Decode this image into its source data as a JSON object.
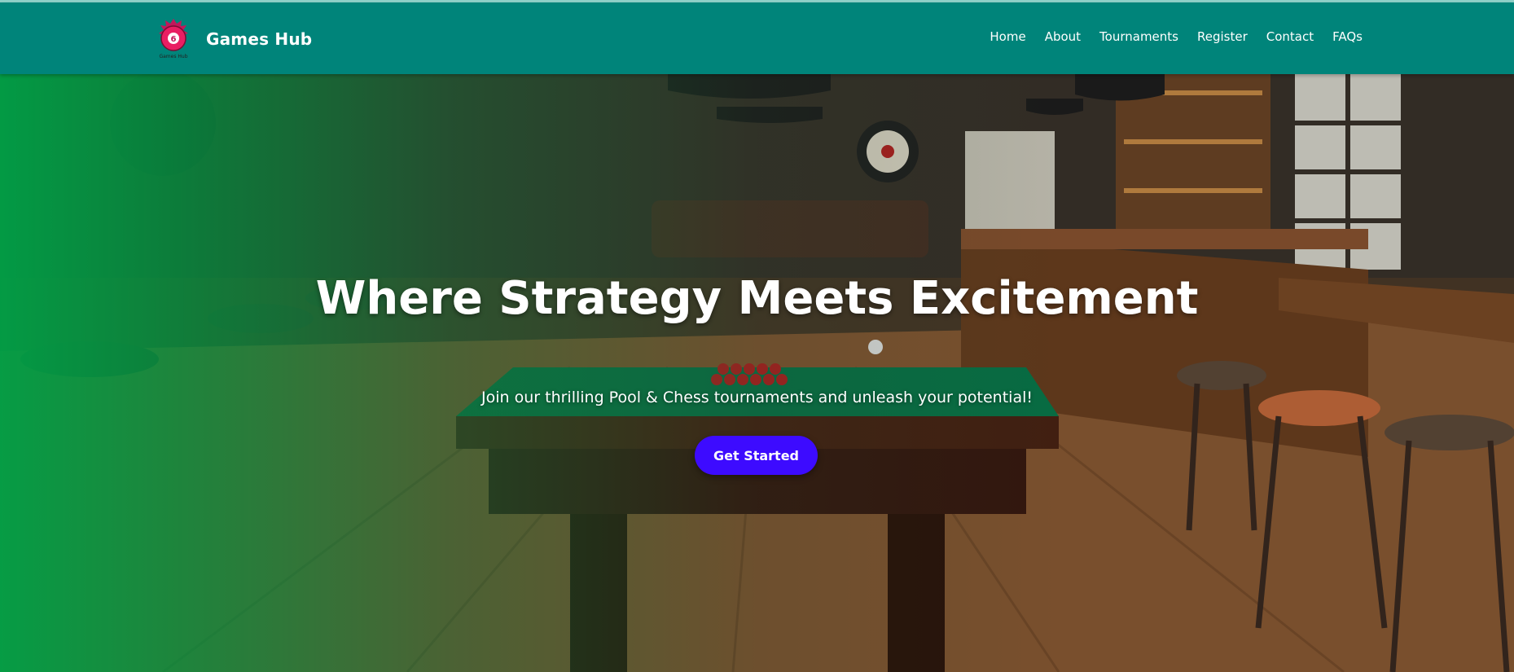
{
  "header": {
    "brand_name": "Games Hub",
    "logo_text": "Games Hub",
    "logo_icon": "pool-ball-logo-icon",
    "bg_color": "#00847a"
  },
  "nav": {
    "items": [
      {
        "label": "Home"
      },
      {
        "label": "About"
      },
      {
        "label": "Tournaments"
      },
      {
        "label": "Register"
      },
      {
        "label": "Contact"
      },
      {
        "label": "FAQs"
      }
    ]
  },
  "hero": {
    "title": "Where Strategy Meets Excitement",
    "subtitle": "Join our thrilling Pool & Chess tournaments and unleash your potential!",
    "cta_label": "Get Started",
    "cta_color": "#3d0bff",
    "overlay_color": "#00a046"
  }
}
